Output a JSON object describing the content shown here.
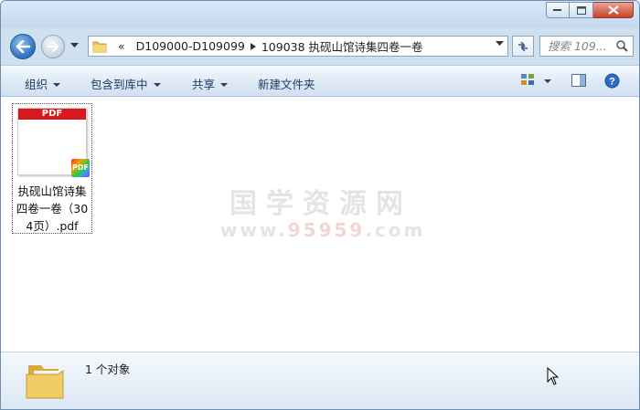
{
  "window": {
    "accent": "#2a6fc2",
    "close_color": "#c7412b"
  },
  "nav": {
    "breadcrumb_prefix": "«",
    "segments": [
      "D109000-D109099",
      "109038 执砚山馆诗集四卷一卷"
    ],
    "search_placeholder": "搜索 109..."
  },
  "toolbar": {
    "organize": "组织",
    "include_library": "包含到库中",
    "share": "共享",
    "new_folder": "新建文件夹"
  },
  "files": [
    {
      "name": "执砚山馆诗集四卷一卷（304页）.pdf",
      "thumb_label": "PDF",
      "badge_label": "PDF"
    }
  ],
  "watermark": {
    "line1": "国学资源网",
    "line2_prefix": "www.",
    "line2_red": "95959",
    "line2_suffix": ".com"
  },
  "status": {
    "count_text": "1 个对象"
  }
}
